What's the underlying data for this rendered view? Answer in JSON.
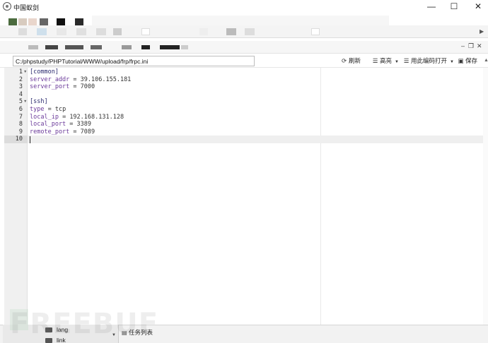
{
  "window": {
    "title": "中国蚁剑",
    "controls": {
      "minimize": "—",
      "maximize": "☐",
      "close": "✕"
    }
  },
  "toolbar": {
    "path_value": "C:/phpstudy/PHPTutorial/WWW/upload/frp/frpc.ini",
    "refresh_label": "刷新",
    "highlight_label": "高亮",
    "open_with_encoding_label": "用此编码打开",
    "save_label": "保存"
  },
  "pane_controls": {
    "minimize": "–",
    "restore": "❐",
    "close": "✕"
  },
  "editor": {
    "line_numbers": [
      "1",
      "2",
      "3",
      "4",
      "5",
      "6",
      "7",
      "8",
      "9",
      "10"
    ],
    "lines": [
      {
        "section": "[common]"
      },
      {
        "key": "server_addr",
        "value": "39.106.155.181"
      },
      {
        "key": "server_port",
        "value": "7000"
      },
      {},
      {
        "section": "[ssh]"
      },
      {
        "key": "type",
        "value": "tcp"
      },
      {
        "key": "local_ip",
        "value": "192.168.131.128"
      },
      {
        "key": "local_port",
        "value": "3389"
      },
      {
        "key": "remote_port",
        "value": "7089"
      },
      {}
    ],
    "active_line": 10
  },
  "file_tree": {
    "items": [
      {
        "label": "lang"
      },
      {
        "label": "link"
      }
    ]
  },
  "bottom_panel": {
    "task_list_label": "任务列表"
  },
  "watermark": "FREEBUF",
  "colors": {
    "gutter": "#f0f0f0",
    "active_line": "#efefef",
    "section": "#2a2a6e",
    "key": "#6b3a9a"
  }
}
